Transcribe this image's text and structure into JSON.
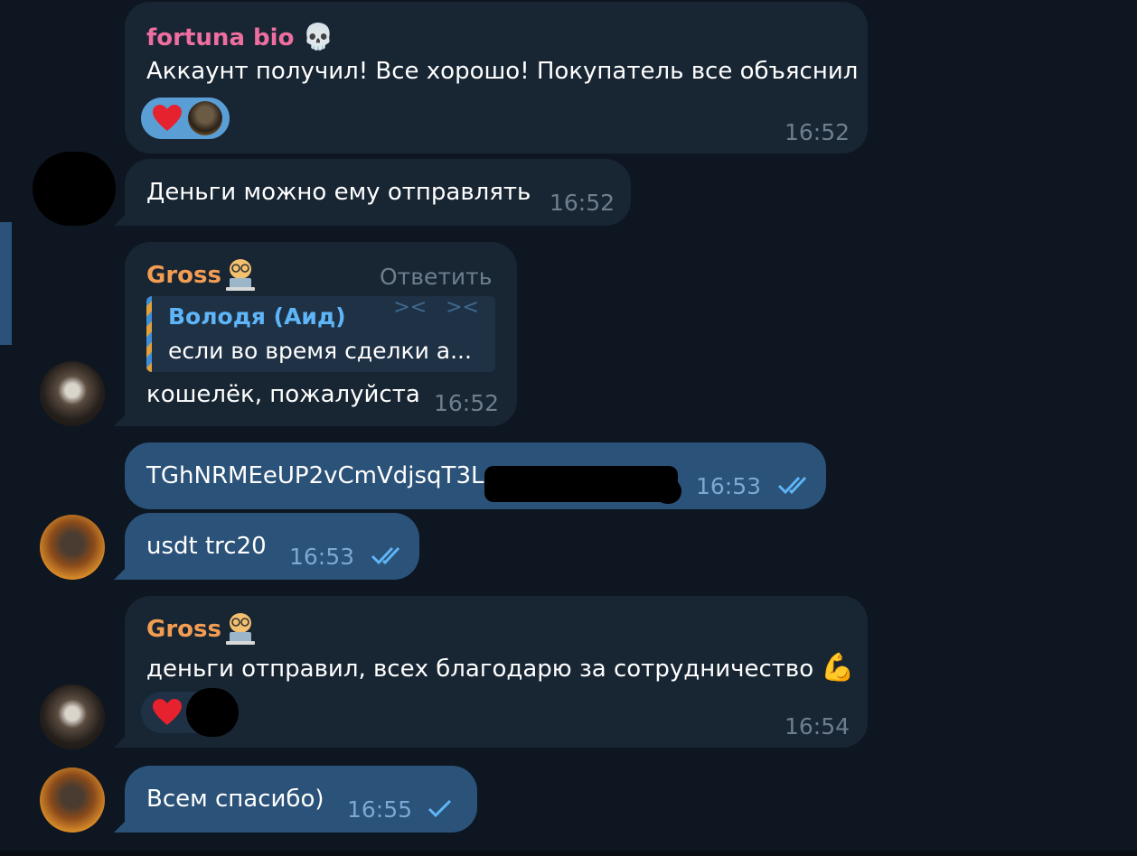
{
  "messages": [
    {
      "id": "m1",
      "sender": "fortuna bio",
      "sender_emoji": "💀",
      "sender_color": "#ee6ea0",
      "text": "Аккаунт получил! Все хорошо! Покупатель все объяснил",
      "time": "16:52",
      "reaction": {
        "emoji": "heart",
        "reactors": 1,
        "style": "chosen"
      }
    },
    {
      "id": "m2",
      "text": "Деньги можно ему отправлять",
      "time": "16:52",
      "avatar": "redacted"
    },
    {
      "id": "m3",
      "sender": "Gross",
      "sender_emoji": "dog-with-laptop",
      "sender_color": "#f29d52",
      "reply_link": "Ответить",
      "quote": {
        "author": "Володя (Аид)",
        "text": "если во время сделки а..."
      },
      "text": "кошелёк, пожалуйста",
      "time": "16:52",
      "avatar": "raccoon"
    },
    {
      "id": "m4",
      "text": "TGhNRMEeUP2vCmVdjsqT3L",
      "time": "16:53",
      "status": "read",
      "outgoing": true
    },
    {
      "id": "m5",
      "text": "usdt trc20",
      "time": "16:53",
      "status": "read",
      "outgoing": true,
      "avatar": "fire-figure"
    },
    {
      "id": "m6",
      "sender": "Gross",
      "sender_emoji": "dog-with-laptop",
      "sender_color": "#f29d52",
      "text": "деньги отправил, всех благодарю за сотрудничество",
      "text_emoji": "💪",
      "time": "16:54",
      "reaction": {
        "emoji": "heart",
        "reactors": 1,
        "style": "plain"
      },
      "avatar": "raccoon"
    },
    {
      "id": "m7",
      "text": "Всем спасибо)",
      "time": "16:55",
      "status": "sent",
      "outgoing": true,
      "avatar": "fire-figure"
    }
  ],
  "colors": {
    "background": "#0e1621",
    "incoming_bubble": "#182533",
    "outgoing_bubble": "#2b5278",
    "time_text": "#6d7f8f",
    "check_marks": "#5eb5f7",
    "heart": "#e5222e"
  }
}
